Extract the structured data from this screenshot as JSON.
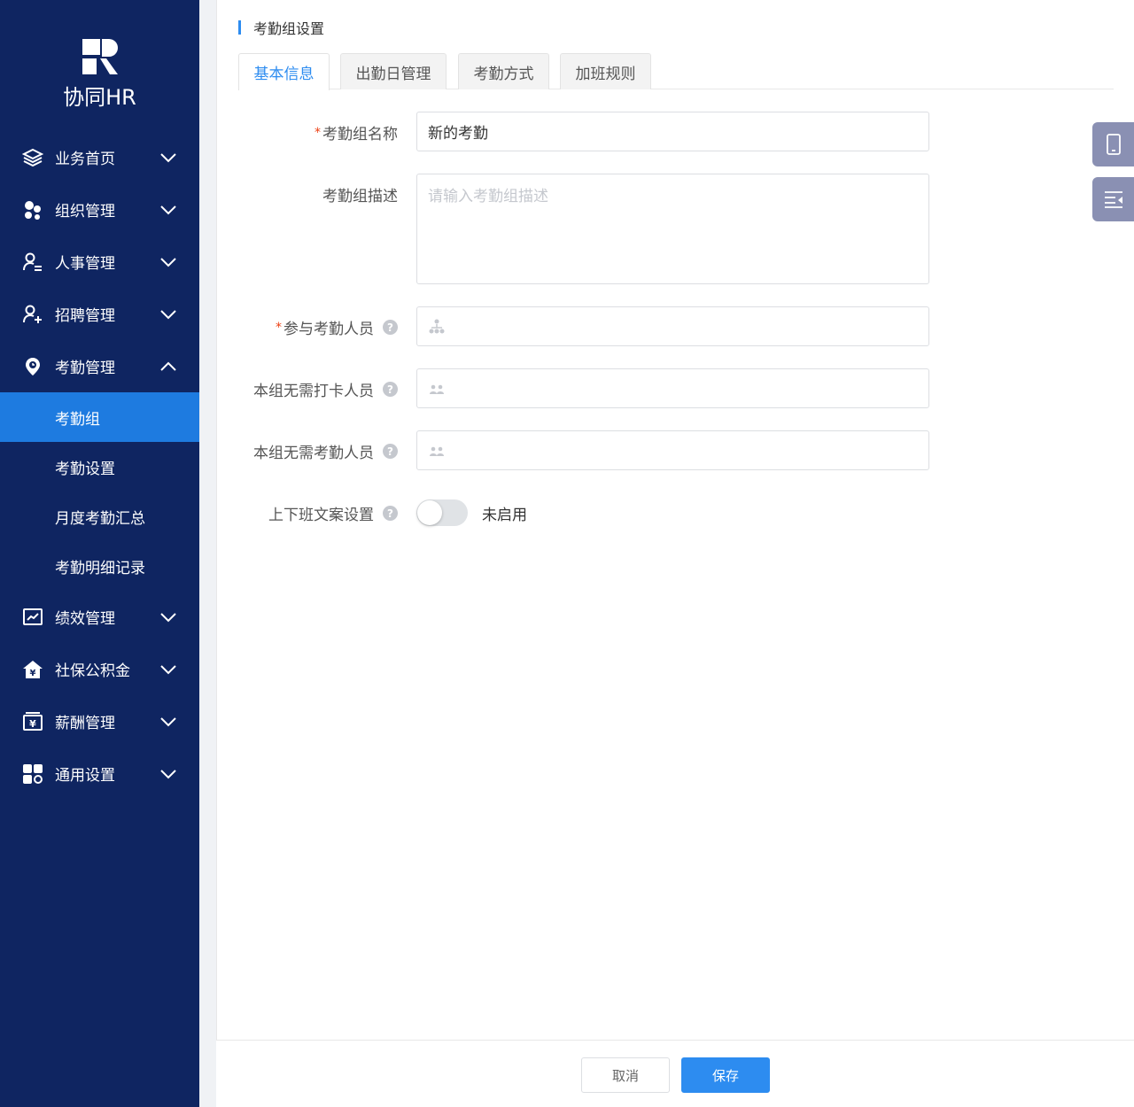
{
  "brand": {
    "logo_text": "协同HR"
  },
  "sidebar": {
    "items": [
      {
        "label": "业务首页",
        "icon": "layers-icon",
        "expanded": false
      },
      {
        "label": "组织管理",
        "icon": "org-icon",
        "expanded": false
      },
      {
        "label": "人事管理",
        "icon": "person-list-icon",
        "expanded": false
      },
      {
        "label": "招聘管理",
        "icon": "person-add-icon",
        "expanded": false
      },
      {
        "label": "考勤管理",
        "icon": "location-pin-icon",
        "expanded": true
      }
    ],
    "sub_items": [
      {
        "label": "考勤组",
        "active": true
      },
      {
        "label": "考勤设置",
        "active": false
      },
      {
        "label": "月度考勤汇总",
        "active": false
      },
      {
        "label": "考勤明细记录",
        "active": false
      }
    ],
    "items_after": [
      {
        "label": "绩效管理",
        "icon": "chart-board-icon"
      },
      {
        "label": "社保公积金",
        "icon": "house-yen-icon"
      },
      {
        "label": "薪酬管理",
        "icon": "wallet-yen-icon"
      },
      {
        "label": "通用设置",
        "icon": "grid-settings-icon"
      }
    ]
  },
  "page": {
    "title": "考勤组设置",
    "tabs": [
      {
        "label": "基本信息",
        "active": true
      },
      {
        "label": "出勤日管理",
        "active": false
      },
      {
        "label": "考勤方式",
        "active": false
      },
      {
        "label": "加班规则",
        "active": false
      }
    ]
  },
  "form": {
    "group_name": {
      "label": "考勤组名称",
      "required": "*",
      "value": "新的考勤"
    },
    "description": {
      "label": "考勤组描述",
      "placeholder": "请输入考勤组描述"
    },
    "participants": {
      "label": "参与考勤人员",
      "required": "*"
    },
    "no_clockin": {
      "label": "本组无需打卡人员"
    },
    "no_attendance": {
      "label": "本组无需考勤人员"
    },
    "shift_text": {
      "label": "上下班文案设置",
      "switch_status": "未启用",
      "enabled": false
    }
  },
  "footer": {
    "cancel_label": "取消",
    "save_label": "保存"
  },
  "colors": {
    "sidebar_bg": "#0f2561",
    "active_item": "#1e7be0",
    "primary": "#2d8cf0",
    "required": "#ed4014"
  }
}
